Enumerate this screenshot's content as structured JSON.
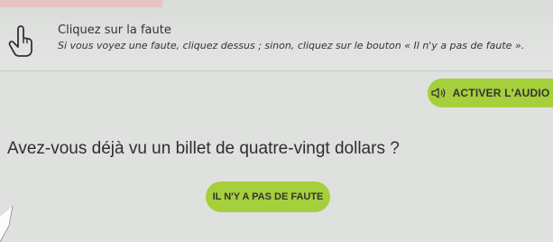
{
  "instructions": {
    "title": "Cliquez sur la faute",
    "text": "Si vous voyez une faute, cliquez dessus ; sinon, cliquez sur le bouton « Il n'y a pas de faute ».",
    "icon": "hand-pointer-icon"
  },
  "audio_button": {
    "label": "ACTIVER L'AUDIO",
    "icon": "speaker-icon"
  },
  "question": {
    "sentence": "Avez-vous déjà vu un billet de quatre-vingt dollars ?"
  },
  "no_error_button": {
    "label": "IL N'Y A PAS DE FAUTE"
  },
  "colors": {
    "accent_green": "#a6cf3c",
    "background": "#dfe1df"
  }
}
